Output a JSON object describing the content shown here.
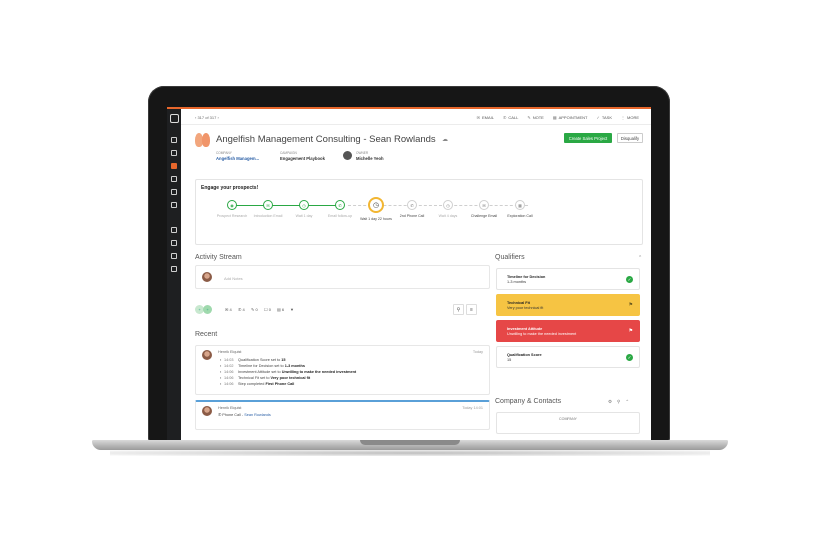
{
  "topbar": {
    "pager": "317 of 317",
    "actions": [
      {
        "icon": "email-icon",
        "label": "EMAIL"
      },
      {
        "icon": "phone-icon",
        "label": "CALL"
      },
      {
        "icon": "note-icon",
        "label": "NOTE"
      },
      {
        "icon": "calendar-icon",
        "label": "APPOINTMENT"
      },
      {
        "icon": "task-icon",
        "label": "TASK"
      },
      {
        "icon": "more-icon",
        "label": "MORE"
      }
    ]
  },
  "header": {
    "title": "Angelfish Management Consulting - Sean Rowlands",
    "create_button": "Create Sales Project",
    "disqualify_button": "Disqualify",
    "company_label": "COMPANY",
    "company_value": "Angelfish Managem...",
    "campaign_label": "CAMPAIGN",
    "campaign_value": "Engagement Playbook",
    "owner_label": "OWNER",
    "owner_value": "Michelle Yeoh"
  },
  "engage": {
    "title": "Engage your prospects!",
    "steps": [
      {
        "label": "Prospect Research",
        "state": "done"
      },
      {
        "label": "Introduction Email",
        "state": "done"
      },
      {
        "label": "Wait 1 day",
        "state": "done"
      },
      {
        "label": "Email follow-up",
        "state": "done"
      },
      {
        "label": "Wait 1 day 22 hours",
        "state": "current"
      },
      {
        "label": "2nd Phone Call",
        "state": "todo"
      },
      {
        "label": "Wait 4 days",
        "state": "todo"
      },
      {
        "label": "Challenge Email",
        "state": "todo"
      },
      {
        "label": "Exploration Call",
        "state": "todo"
      }
    ]
  },
  "activity": {
    "title": "Activity Stream",
    "placeholder": "Add Notes",
    "filters": [
      "4",
      "4",
      "0",
      "0",
      "6"
    ],
    "recent_title": "Recent"
  },
  "feed": [
    {
      "name": "Henrik Elquist",
      "date": "Today",
      "lines": [
        {
          "time": "14:03",
          "text": "Qualification Score set to ",
          "bold": "15"
        },
        {
          "time": "14:02",
          "text": "Timeline for Decision set to ",
          "bold": "1-3 months"
        },
        {
          "time": "14:06",
          "text": "Investment Attitude set to ",
          "bold": "Unwilling to make the needed investment"
        },
        {
          "time": "14:06",
          "text": "Technical Fit set to ",
          "bold": "Very poor technical fit"
        },
        {
          "time": "14:06",
          "text": "Step completed ",
          "bold": "First Phone Call"
        }
      ]
    },
    {
      "name": "Henrik Elquist",
      "date": "Today 14:01",
      "sub_prefix": "Phone Call - ",
      "sub_link": "Sean Rowlands"
    }
  ],
  "qualifiers": {
    "title": "Qualifiers",
    "items": [
      {
        "title": "Timeline for Decision",
        "value": "1-3 months",
        "state": "ok"
      },
      {
        "title": "Technical Fit",
        "value": "Very poor technical fit",
        "state": "warn"
      },
      {
        "title": "Investment Attitude",
        "value": "Unwilling to make the needed investment",
        "state": "bad"
      },
      {
        "title": "Qualification Score",
        "value": "15",
        "state": "ok"
      }
    ]
  },
  "company_contacts": {
    "title": "Company & Contacts",
    "company_header": "COMPANY"
  },
  "colors": {
    "accent": "#e8672c",
    "green": "#2aa844",
    "yellow": "#f6c443",
    "red": "#e64747"
  }
}
